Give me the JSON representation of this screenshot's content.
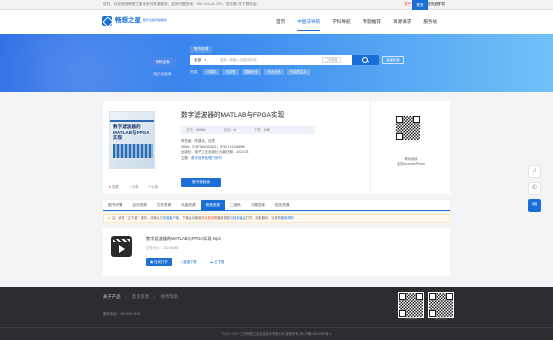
{
  "topbar": {
    "tip": "您好，欢迎使用畅想之星全系列资源服务。如有问题咨询：180-104-41-221；您还剩",
    "tip_highlight": "0",
    "tip_tail": "次下载机会！",
    "member_download": "资产云下载",
    "free_download": "遗失月下载",
    "login": "登录",
    "register": "注册"
  },
  "header": {
    "logo_name": "畅想之星",
    "logo_sub": "数字出版传播服务",
    "nav": [
      "首页",
      "中图法导航",
      "学科导航",
      "专题推荐",
      "资源请求",
      "服务站"
    ],
    "active_nav": 1
  },
  "hero": {
    "side_active": "学科检索",
    "side_other": "知识点检索",
    "tab_chip": "图书资源",
    "select_value": "全部",
    "search_placeholder": "搜索 | 请输入关键词检索",
    "search_mode": "二次检索",
    "advanced": "高级检索",
    "hot_label": "热搜：",
    "hot_tags": [
      "计算机",
      "马克思",
      "国家安全",
      "可大艺术",
      "马克思主义"
    ]
  },
  "book": {
    "title": "数字滤波器的MATLAB与FPGA实现",
    "cover_title": "数字滤波器的MATLAB与FPGA实现",
    "meta": {
      "views_label": "浏览：",
      "views": "30961",
      "read_label": "阅读：",
      "read": "6",
      "dl_label": "下载：",
      "dl": "198"
    },
    "author": "责任者：陈建功、杜勇",
    "isbn": "ISBN：9787894322821；9787121158698",
    "publisher_line": "出版社：电子工业出版社  出版日期：2012.03",
    "subject_label": "主题：",
    "subject": "数字信号处理门系列",
    "download_btn": "借书我就读",
    "actions": {
      "fav": "收藏",
      "share": "分享",
      "cite": "引用"
    }
  },
  "qr": {
    "caption_line1": "移动阅读",
    "caption_line2": "支持Android/iPhone"
  },
  "tabs": [
    "图书详情",
    "目次资源",
    "文件资源",
    "光盘资源",
    "视频资源",
    "二维码",
    "习题答案",
    "相关资源"
  ],
  "active_tab": 4,
  "notice": {
    "prefix": "注：该任〝云下载〞操作，请确认已",
    "highlight1": "安装客户端",
    "middle": "，下载后请使用",
    "highlight2": "你认真说明",
    "middle2": "播放视频",
    "highlight3": "已经安装",
    "suffix": "后打开，如有疑问，请查看",
    "help": "使用帮助"
  },
  "file": {
    "name": "数字滤波器的MATLAB与FPGA实现.mp4",
    "size": "文件大小：102.48MB",
    "btn_open": "在线打开",
    "btn_normal": "普通下载",
    "btn_cloud": "云下载"
  },
  "footer": {
    "about": "关于产品",
    "contact": "意见反馈",
    "help": "使用帮助",
    "service": "服务热线：400-600-4011",
    "qr1_caption": "手机网站",
    "qr2_caption": "官方微信",
    "copyright": "©2017-2027 江苏畅想之星信息技术有限公司 版权所有 苏ICP备15023359号-1"
  }
}
